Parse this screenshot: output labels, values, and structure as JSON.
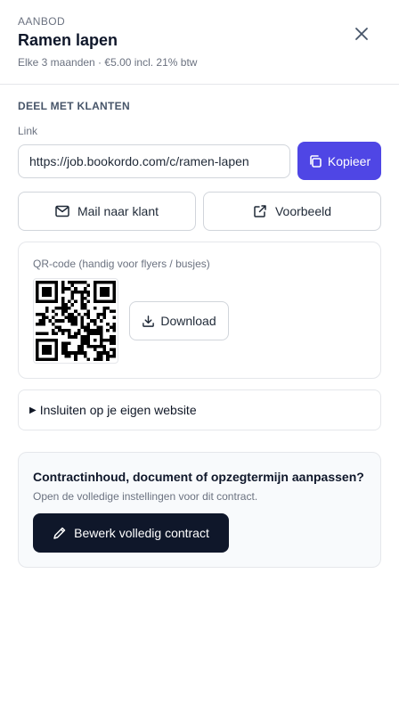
{
  "header": {
    "eyebrow": "AANBOD",
    "title": "Ramen lapen",
    "subtitle": "Elke 3 maanden · €5.00 incl. 21% btw"
  },
  "share": {
    "section_title": "DEEL MET KLANTEN",
    "link_label": "Link",
    "link_value": "https://job.bookordo.com/c/ramen-lapen",
    "copy_label": "Kopieer",
    "mail_label": "Mail naar klant",
    "preview_label": "Voorbeeld"
  },
  "qr": {
    "label": "QR-code (handig voor flyers / busjes)",
    "download_label": "Download"
  },
  "embed": {
    "label": "Insluiten op je eigen website"
  },
  "contract": {
    "title": "Contractinhoud, document of opzegtermijn aanpassen?",
    "description": "Open de volledige instellingen voor dit contract.",
    "edit_label": "Bewerk volledig contract"
  },
  "colors": {
    "accent": "#4f46e5",
    "dark": "#0f172a",
    "border": "#d1d5db",
    "muted": "#6b7280"
  }
}
